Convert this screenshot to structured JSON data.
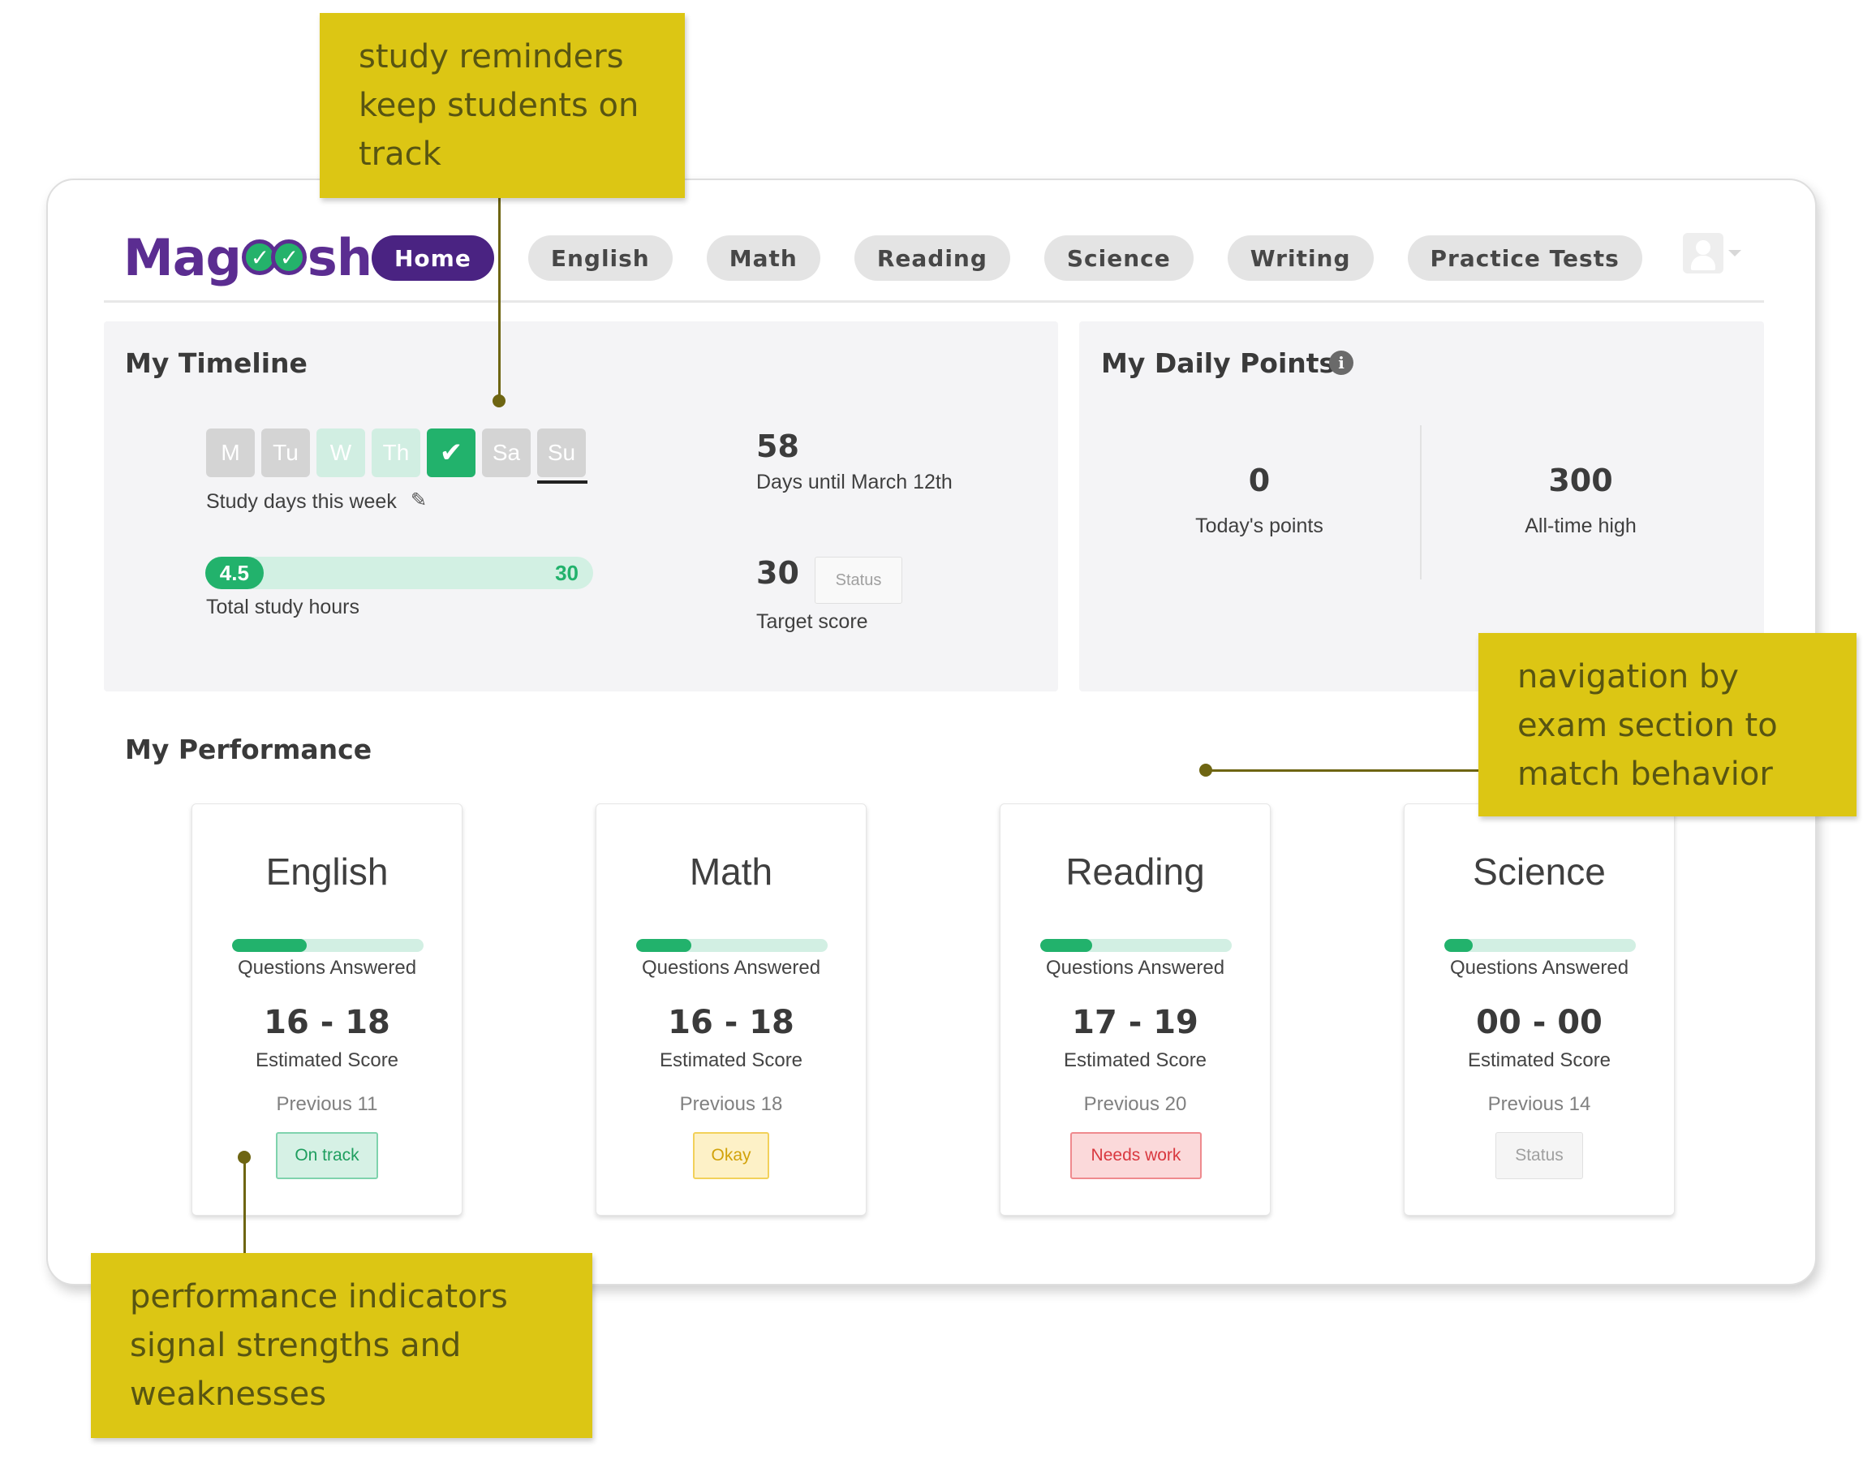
{
  "header": {
    "logo_left": "Mag",
    "logo_right": "sh",
    "nav": [
      {
        "label": "Home",
        "active": true
      },
      {
        "label": "English"
      },
      {
        "label": "Math"
      },
      {
        "label": "Reading"
      },
      {
        "label": "Science"
      },
      {
        "label": "Writing"
      },
      {
        "label": "Practice Tests"
      }
    ]
  },
  "timeline": {
    "title": "My Timeline",
    "days": [
      {
        "label": "M",
        "state": "grey"
      },
      {
        "label": "Tu",
        "state": "grey"
      },
      {
        "label": "W",
        "state": "mint"
      },
      {
        "label": "Th",
        "state": "mint"
      },
      {
        "label": "✔",
        "state": "done"
      },
      {
        "label": "Sa",
        "state": "grey"
      },
      {
        "label": "Su",
        "state": "grey",
        "current": true
      }
    ],
    "study_days_label": "Study days this week",
    "edit_icon": "pencil-icon",
    "hours_value": "4.5",
    "hours_max": "30",
    "hours_progress": 0.15,
    "hours_label": "Total study hours",
    "days_until": "58",
    "days_until_label": "Days until March 12th",
    "target_score": "30",
    "target_status": "Status",
    "target_label": "Target score"
  },
  "points": {
    "title": "My Daily Points",
    "info_icon": "info-icon",
    "today_value": "0",
    "today_label": "Today's points",
    "high_value": "300",
    "high_label": "All-time high"
  },
  "performance": {
    "title": "My Performance",
    "cards": [
      {
        "subject": "English",
        "progress": 0.39,
        "questions_label": "Questions Answered",
        "score": "16 - 18",
        "score_label": "Estimated Score",
        "previous": "Previous 11",
        "status": "On track"
      },
      {
        "subject": "Math",
        "progress": 0.29,
        "questions_label": "Questions Answered",
        "score": "16 - 18",
        "score_label": "Estimated Score",
        "previous": "Previous 18",
        "status": "Okay"
      },
      {
        "subject": "Reading",
        "progress": 0.27,
        "questions_label": "Questions Answered",
        "score": "17 - 19",
        "score_label": "Estimated Score",
        "previous": "Previous 20",
        "status": "Needs work"
      },
      {
        "subject": "Science",
        "progress": 0.15,
        "questions_label": "Questions Answered",
        "score": "00 - 00",
        "score_label": "Estimated Score",
        "previous": "Previous 14",
        "status": "Status"
      }
    ]
  },
  "annotations": {
    "reminders": [
      "study reminders",
      "keep students on",
      "track"
    ],
    "navigation": [
      "navigation by",
      "exam section to",
      "match behavior"
    ],
    "indicators": [
      "performance indicators",
      "signal strengths and",
      "weaknesses"
    ]
  },
  "colors": {
    "brand_purple": "#5b2d91",
    "success_green": "#22b26c",
    "annotation_yellow": "#dcc614",
    "status_on_track_bg": "#d6f1e5",
    "status_okay_bg": "#fdf1c7",
    "status_needs_work_bg": "#fbd9da"
  }
}
